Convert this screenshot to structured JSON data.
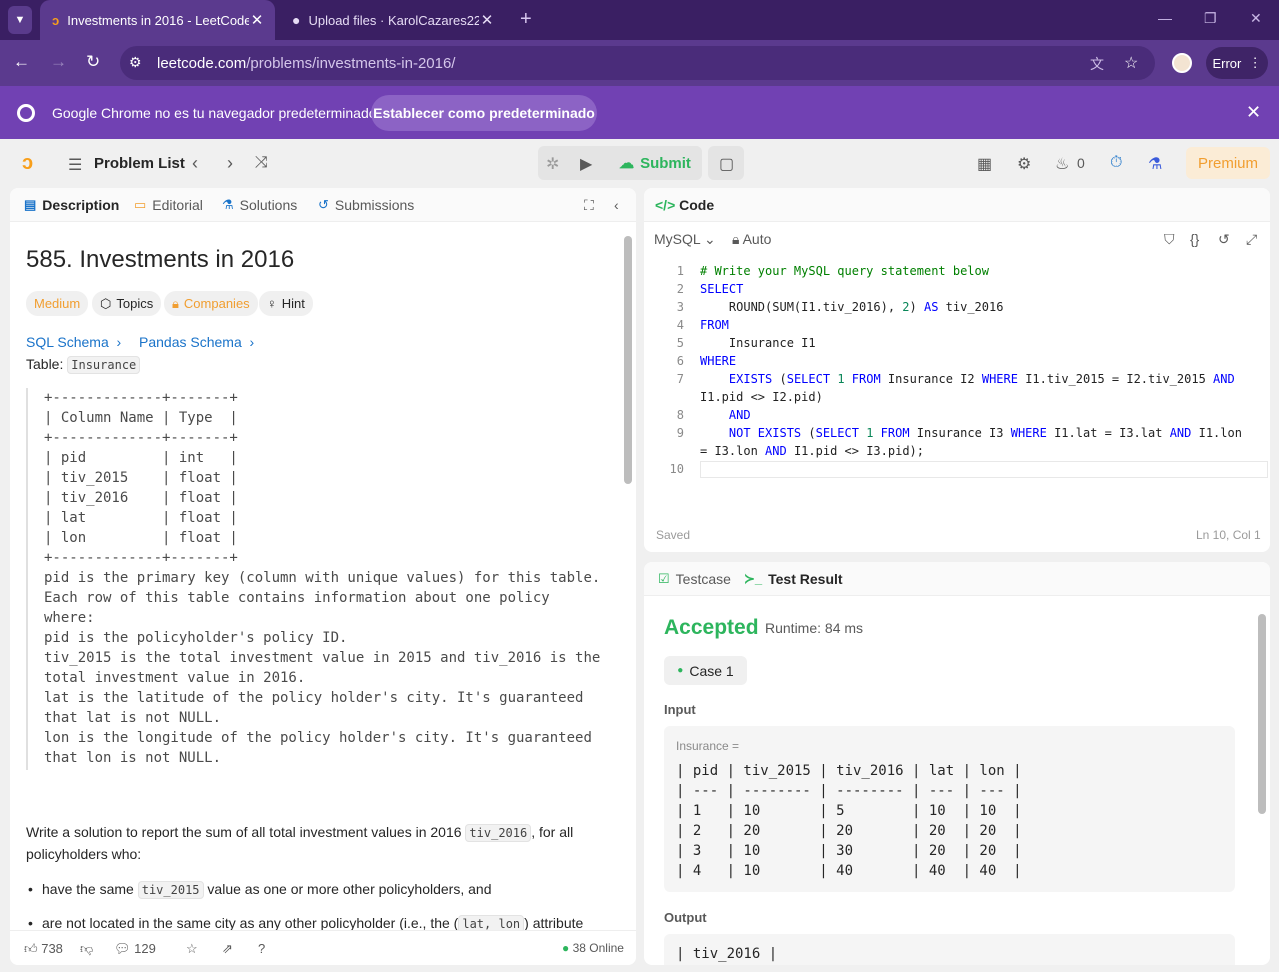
{
  "browser": {
    "tabs": [
      {
        "title": "Investments in 2016 - LeetCode",
        "active": true
      },
      {
        "title": "Upload files · KarolCazares223/L",
        "active": false
      }
    ],
    "url_host": "leetcode.com",
    "url_path": "/problems/investments-in-2016/",
    "error_label": "Error",
    "infobar": {
      "text": "Google Chrome no es tu navegador predeterminado",
      "button": "Establecer como predeterminado"
    }
  },
  "header": {
    "problem_list": "Problem List",
    "submit": "Submit",
    "streak": "0",
    "premium": "Premium"
  },
  "left": {
    "tabs": [
      "Description",
      "Editorial",
      "Solutions",
      "Submissions"
    ],
    "title": "585. Investments in 2016",
    "chips": [
      "Medium",
      "Topics",
      "Companies",
      "Hint"
    ],
    "links": [
      "SQL Schema",
      "Pandas Schema"
    ],
    "table_label": "Table:",
    "table_name": "Insurance",
    "schema": "+-------------+-------+\n| Column Name | Type  |\n+-------------+-------+\n| pid         | int   |\n| tiv_2015    | float |\n| tiv_2016    | float |\n| lat         | float |\n| lon         | float |\n+-------------+-------+\npid is the primary key (column with unique values) for this table.\nEach row of this table contains information about one policy\nwhere:\npid is the policyholder's policy ID.\ntiv_2015 is the total investment value in 2015 and tiv_2016 is the\ntotal investment value in 2016.\nlat is the latitude of the policy holder's city. It's guaranteed\nthat lat is not NULL.\nlon is the longitude of the policy holder's city. It's guaranteed\nthat lon is not NULL.",
    "desc_pre": "Write a solution to report the sum of all total investment values in 2016 ",
    "desc_code": "tiv_2016",
    "desc_post": ", for all policyholders who:",
    "bullet1_pre": "have the same ",
    "bullet1_code": "tiv_2015",
    "bullet1_post": " value as one or more other policyholders, and",
    "bullet2_pre": "are not located in the same city as any other policyholder (i.e., the (",
    "bullet2_code": "lat, lon",
    "bullet2_post": ") attribute",
    "likes": "738",
    "comments": "129",
    "online": "38 Online"
  },
  "code": {
    "title": "Code",
    "language": "MySQL",
    "mode": "Auto",
    "saved": "Saved",
    "position": "Ln 10, Col 1"
  },
  "test": {
    "tabs": [
      "Testcase",
      "Test Result"
    ],
    "status": "Accepted",
    "runtime": "Runtime: 84 ms",
    "case": "Case 1",
    "input_label": "Input",
    "input_var": "Insurance =",
    "input_table": "| pid | tiv_2015 | tiv_2016 | lat | lon |\n| --- | -------- | -------- | --- | --- |\n| 1   | 10       | 5        | 10  | 10  |\n| 2   | 20       | 20       | 20  | 20  |\n| 3   | 10       | 30       | 20  | 20  |\n| 4   | 10       | 40       | 40  | 40  |",
    "output_label": "Output",
    "output_table": "| tiv_2016 |"
  },
  "colors": {
    "accepted": "#2db55d",
    "link": "#1a73c9",
    "medium": "#f19e30"
  }
}
